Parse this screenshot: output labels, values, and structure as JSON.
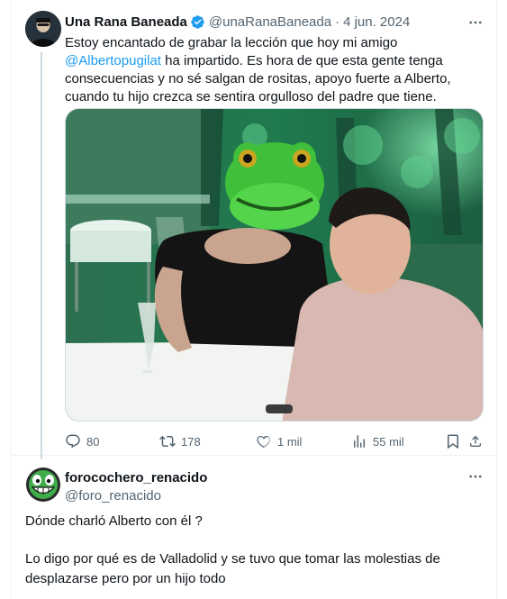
{
  "tweet": {
    "name": "Una Rana Baneada",
    "handle": "@unaRanaBaneada",
    "date": "4 jun. 2024",
    "text_before": "Estoy encantado de grabar la lección que hoy mi amigo ",
    "mention": "@Albertopugilat",
    "text_after": " ha impartido. Es hora de que esta gente tenga consecuencias y no sé salgan de rositas, apoyo fuerte a Alberto, cuando tu hijo crezca se sentira orgulloso del padre que tiene.",
    "stats": {
      "replies": "80",
      "retweets": "178",
      "likes": "1 mil",
      "views": "55 mil"
    }
  },
  "reply": {
    "name": "forocochero_renacido",
    "handle": "@foro_renacido",
    "paragraph1": "Dónde charló Alberto con él ?",
    "paragraph2": "Lo digo por qué es de Valladolid y se tuvo que tomar las molestias de desplazarse pero por un hijo todo"
  },
  "colors": {
    "accent": "#1d9bf0",
    "muted": "#536471",
    "text": "#0f1419"
  },
  "icons": {
    "verified": "verified-badge-icon",
    "more": "more-options-icon",
    "reply": "reply-bubble-icon",
    "retweet": "retweet-icon",
    "like": "heart-icon",
    "views": "bar-chart-icon",
    "bookmark": "bookmark-icon",
    "share": "share-icon"
  }
}
